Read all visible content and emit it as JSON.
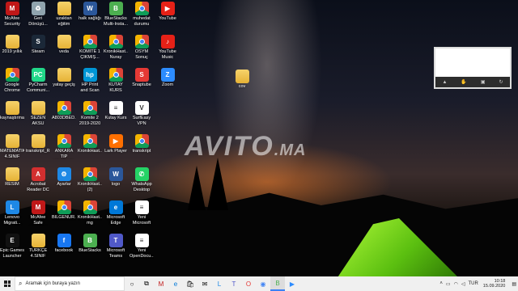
{
  "watermark": {
    "brand": "AVITO",
    "tld": ".MA"
  },
  "desktop_icons": [
    {
      "label": "McAfee Security Sc...",
      "icon": "mcafee-icon",
      "color": "#c01818"
    },
    {
      "label": "2019 yıllık",
      "icon": "folder-icon",
      "color": "#e8b43a"
    },
    {
      "label": "Google Chrome",
      "icon": "chrome-icon",
      "color": "#4285f4"
    },
    {
      "label": "kaynaştırma",
      "icon": "folder-icon",
      "color": "#e8b43a"
    },
    {
      "label": "MATEMATİK 4.SINIF KU...",
      "icon": "folder-icon",
      "color": "#e8b43a"
    },
    {
      "label": "RESİM",
      "icon": "folder-icon",
      "color": "#e8b43a"
    },
    {
      "label": "Lenovo Migrati...",
      "icon": "lenovo-icon",
      "color": "#1e88e5"
    },
    {
      "label": "Epic Games Launcher",
      "icon": "epic-icon",
      "color": "#111111"
    },
    {
      "label": "Geri Dönüşü...",
      "icon": "recycle-bin-icon",
      "color": "#90a4ae"
    },
    {
      "label": "Steam",
      "icon": "steam-icon",
      "color": "#1b2838"
    },
    {
      "label": "PyCharm Communi...",
      "icon": "pycharm-icon",
      "color": "#21d789"
    },
    {
      "label": "SEZEN AKSU",
      "icon": "folder-icon",
      "color": "#e8b43a"
    },
    {
      "label": "transkript_R...",
      "icon": "folder-icon",
      "color": "#e8b43a"
    },
    {
      "label": "Acrobat Reader DC",
      "icon": "acrobat-icon",
      "color": "#d32f2f"
    },
    {
      "label": "McAfee Safe Connect",
      "icon": "mcafee-icon",
      "color": "#c01818"
    },
    {
      "label": "TÜRKÇE 4.SINIF KUS",
      "icon": "folder-icon",
      "color": "#e8b43a"
    },
    {
      "label": "uzaktan eğitim",
      "icon": "folder-icon",
      "color": "#e8b43a"
    },
    {
      "label": "veda",
      "icon": "folder-icon",
      "color": "#e8b43a"
    },
    {
      "label": "yatay geçiş",
      "icon": "folder-icon",
      "color": "#e8b43a"
    },
    {
      "label": "A803DBED...",
      "icon": "chrome-icon",
      "color": "#4285f4"
    },
    {
      "label": "ANKARA TIP yatayGeciş...",
      "icon": "chrome-icon",
      "color": "#4285f4"
    },
    {
      "label": "Ayarlar",
      "icon": "gear-icon",
      "color": "#1e88e5"
    },
    {
      "label": "BİLGENUR...",
      "icon": "chrome-icon",
      "color": "#4285f4"
    },
    {
      "label": "facebook",
      "icon": "facebook-icon",
      "color": "#1877f2"
    },
    {
      "label": "halk sağlığı",
      "icon": "word-icon",
      "color": "#2b579a"
    },
    {
      "label": "KOMİTE 1 ÇIKMIŞ...",
      "icon": "chrome-icon",
      "color": "#4285f4"
    },
    {
      "label": "HP Print and Scan Doctor",
      "icon": "hp-icon",
      "color": "#0096d6"
    },
    {
      "label": "Komite 2 2019-2020",
      "icon": "chrome-icon",
      "color": "#4285f4"
    },
    {
      "label": "KronikHast...",
      "icon": "chrome-icon",
      "color": "#4285f4"
    },
    {
      "label": "KronikHast... (2)",
      "icon": "chrome-icon",
      "color": "#4285f4"
    },
    {
      "label": "KronikHast... mg",
      "icon": "chrome-icon",
      "color": "#4285f4"
    },
    {
      "label": "BlueStacks",
      "icon": "bluestacks-icon",
      "color": "#4caf50"
    },
    {
      "label": "BlueStacks Multi-Insta...",
      "icon": "bluestacks-icon",
      "color": "#4caf50"
    },
    {
      "label": "KronikHast... Nuray ALTAY",
      "icon": "chrome-icon",
      "color": "#4285f4"
    },
    {
      "label": "KUTAY KURS",
      "icon": "chrome-icon",
      "color": "#4285f4"
    },
    {
      "label": "Kutay Kurs",
      "icon": "document-icon",
      "color": "#ffffff"
    },
    {
      "label": "Lark Player",
      "icon": "lark-player-icon",
      "color": "#ff6f00"
    },
    {
      "label": "logo",
      "icon": "word-icon",
      "color": "#2b579a"
    },
    {
      "label": "Microsoft Edge",
      "icon": "edge-icon",
      "color": "#0078d7"
    },
    {
      "label": "Microsoft Teams",
      "icon": "teams-icon",
      "color": "#5059c9"
    },
    {
      "label": "muhedat durumu",
      "icon": "chrome-icon",
      "color": "#4285f4"
    },
    {
      "label": "ÖSYM Sonuç Açıklama S...",
      "icon": "chrome-icon",
      "color": "#4285f4"
    },
    {
      "label": "Snaptube",
      "icon": "snaptube-icon",
      "color": "#e53935"
    },
    {
      "label": "SurfEasy VPN",
      "icon": "vpn-icon",
      "color": "#ffffff"
    },
    {
      "label": "transkript",
      "icon": "chrome-icon",
      "color": "#4285f4"
    },
    {
      "label": "WhatsApp Desktop",
      "icon": "whatsapp-icon",
      "color": "#25d366"
    },
    {
      "label": "Yeni Microsoft",
      "icon": "document-icon",
      "color": "#ffffff"
    },
    {
      "label": "Yeni OpenDocu...",
      "icon": "document-icon",
      "color": "#ffffff"
    },
    {
      "label": "YouTube",
      "icon": "youtube-icon",
      "color": "#e62117"
    },
    {
      "label": "YouTube Music",
      "icon": "youtube-music-icon",
      "color": "#e62117"
    },
    {
      "label": "Zoom",
      "icon": "zoom-icon",
      "color": "#2d8cff"
    },
    {
      "label": "cov",
      "icon": "folder-icon",
      "color": "#e8b43a"
    }
  ],
  "taskbar": {
    "search_placeholder": "Aramak için buraya yazın",
    "pinned_icons": [
      "cortana-icon",
      "task-view-icon",
      "mcafee-icon",
      "edge-icon",
      "store-icon",
      "mail-icon",
      "lenovo-icon",
      "teams-icon",
      "opera-icon",
      "chrome-icon",
      "bluestacks-icon",
      "zoom-icon"
    ],
    "tray": {
      "lang": "TUR",
      "time": "10:18",
      "date": "15.09.2020"
    }
  }
}
